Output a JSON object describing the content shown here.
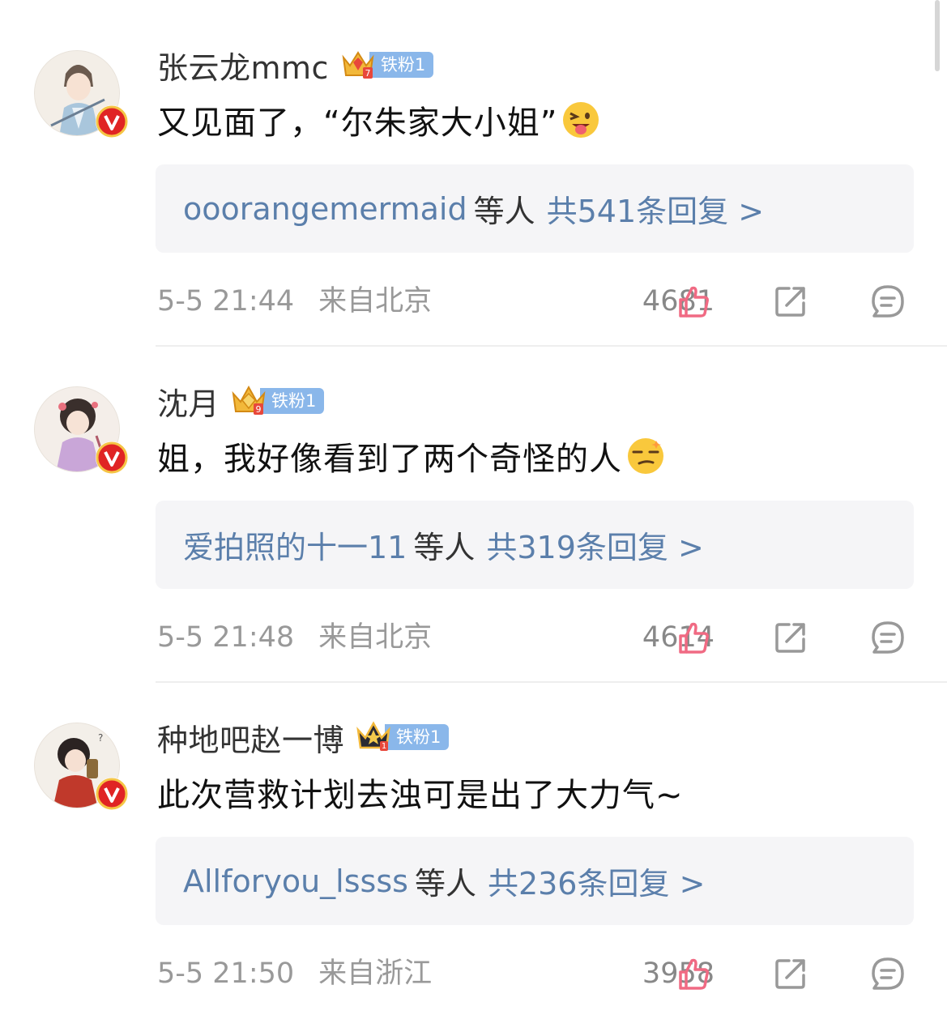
{
  "colors": {
    "link": "#5b7fab",
    "fan_badge": "#8ab7ea",
    "like_icon": "#f06a83",
    "verified": "#e02424",
    "crown_gold": "#f2b83a"
  },
  "comments": [
    {
      "username": "张云龙mmc",
      "fan_badge": "铁粉1",
      "crown_icon": "gold-crown-level-7-icon",
      "text": "又见面了，“尔朱家大小姐”",
      "emoji": "tongue-wink-emoji",
      "reply_users": "ooorangemermaid",
      "reply_mid": "等人",
      "reply_count": "共541条回复 >",
      "time": "5-5 21:44",
      "location": "来自北京",
      "likes": "4681"
    },
    {
      "username": "沈月",
      "fan_badge": "铁粉1",
      "crown_icon": "gold-crown-level-9-icon",
      "text": "姐，我好像看到了两个奇怪的人",
      "emoji": "smirk-emoji",
      "reply_users": "爱拍照的十一11",
      "reply_mid": "等人",
      "reply_count": "共319条回复 >",
      "time": "5-5 21:48",
      "location": "来自北京",
      "likes": "4614"
    },
    {
      "username": "种地吧赵一博",
      "fan_badge": "铁粉1",
      "crown_icon": "black-crown-level-1-icon",
      "text": "此次营救计划去浊可是出了大力气~",
      "emoji": "",
      "reply_users": "Allforyou_lssss",
      "reply_mid": "等人",
      "reply_count": "共236条回复 >",
      "time": "5-5 21:50",
      "location": "来自浙江",
      "likes": "3958"
    }
  ]
}
